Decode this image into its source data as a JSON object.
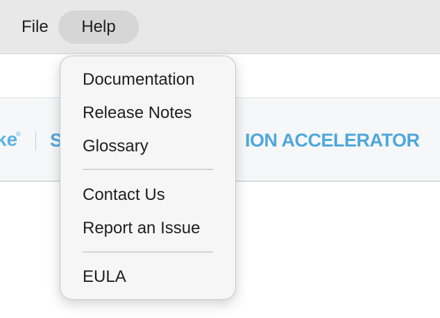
{
  "menubar": {
    "file_label": "File",
    "help_label": "Help"
  },
  "banner": {
    "logo_fragment": "ke",
    "logo_mark": "®",
    "title_left_fragment": "S",
    "title_right_fragment": "ION ACCELERATOR",
    "accent_color": "#4fa8dc"
  },
  "help_menu": {
    "items": [
      {
        "label": "Documentation"
      },
      {
        "label": "Release Notes"
      },
      {
        "label": "Glossary"
      },
      {
        "label": "Contact Us"
      },
      {
        "label": "Report an Issue"
      },
      {
        "label": "EULA"
      }
    ]
  }
}
